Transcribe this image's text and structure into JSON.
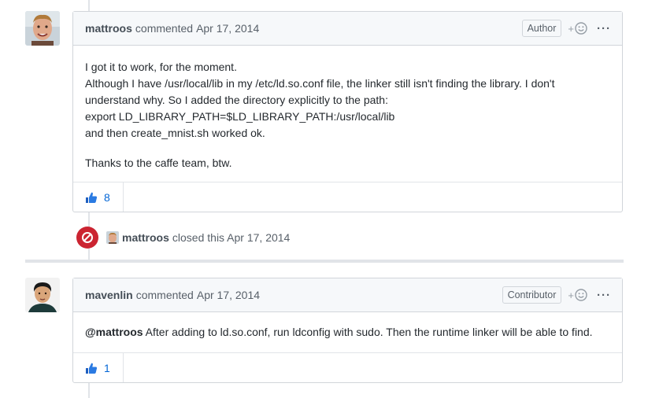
{
  "comments": [
    {
      "author": "mattroos",
      "action": "commented",
      "date": "Apr 17, 2014",
      "role": "Author",
      "body_lines": [
        "I got it to work, for the moment.",
        "Although I have /usr/local/lib in my /etc/ld.so.conf file, the linker still isn't finding the library. I don't",
        "understand why. So I added the directory explicitly to the path:",
        "export LD_LIBRARY_PATH=$LD_LIBRARY_PATH:/usr/local/lib",
        "and then create_mnist.sh worked ok."
      ],
      "body_closing": "Thanks to the caffe team, btw.",
      "reaction_icon": "thumbs-up-icon",
      "reaction_count": "8"
    },
    {
      "author": "mavenlin",
      "action": "commented",
      "date": "Apr 17, 2014",
      "role": "Contributor",
      "mention": "@mattroos",
      "body_text": " After adding to ld.so.conf, run ldconfig with sudo. Then the runtime linker will be able to find.",
      "reaction_icon": "thumbs-up-icon",
      "reaction_count": "1"
    }
  ],
  "event": {
    "actor": "mattroos",
    "text": "closed this Apr 17, 2014",
    "icon": "closed-circle-icon"
  },
  "header_icons": {
    "add_reaction": "smiley-plus-icon",
    "more": "kebab-icon",
    "more_glyph": "···",
    "plus_glyph": "+"
  },
  "colors": {
    "closed_red": "#cb2431",
    "link_blue": "#0366d6",
    "header_bg": "#f6f8fa",
    "border": "#d1d5da"
  }
}
